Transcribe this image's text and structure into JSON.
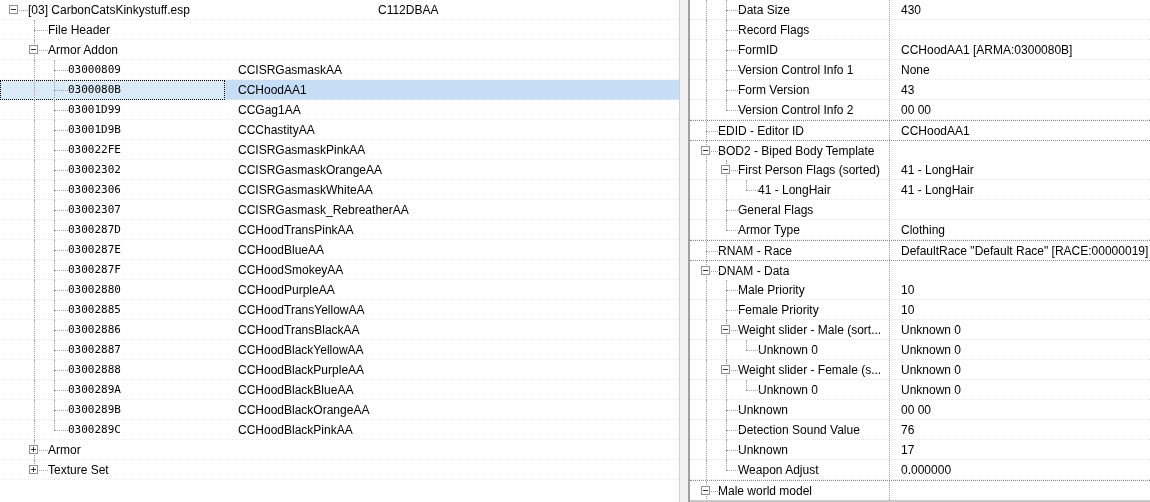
{
  "left_pane": {
    "tree": [
      {
        "label": "[03] CarbonCatsKinkystuff.esp",
        "column_3": "C112DBAA",
        "expanded": true,
        "children": [
          {
            "label": "File Header"
          },
          {
            "label": "Armor Addon",
            "expanded": true,
            "children": [
              {
                "kind": "record",
                "form_id": "03000809",
                "editor_id": "CCISRGasmaskAA",
                "selected": false
              },
              {
                "kind": "record",
                "form_id": "0300080B",
                "editor_id": "CCHoodAA1",
                "selected": true
              },
              {
                "kind": "record",
                "form_id": "03001D99",
                "editor_id": "CCGag1AA",
                "selected": false
              },
              {
                "kind": "record",
                "form_id": "03001D9B",
                "editor_id": "CCChastityAA",
                "selected": false
              },
              {
                "kind": "record",
                "form_id": "030022FE",
                "editor_id": "CCISRGasmaskPinkAA",
                "selected": false
              },
              {
                "kind": "record",
                "form_id": "03002302",
                "editor_id": "CCISRGasmaskOrangeAA",
                "selected": false
              },
              {
                "kind": "record",
                "form_id": "03002306",
                "editor_id": "CCISRGasmaskWhiteAA",
                "selected": false
              },
              {
                "kind": "record",
                "form_id": "03002307",
                "editor_id": "CCISRGasmask_RebreatherAA",
                "selected": false
              },
              {
                "kind": "record",
                "form_id": "0300287D",
                "editor_id": "CCHoodTransPinkAA",
                "selected": false
              },
              {
                "kind": "record",
                "form_id": "0300287E",
                "editor_id": "CCHoodBlueAA",
                "selected": false
              },
              {
                "kind": "record",
                "form_id": "0300287F",
                "editor_id": "CCHoodSmokeyAA",
                "selected": false
              },
              {
                "kind": "record",
                "form_id": "03002880",
                "editor_id": "CCHoodPurpleAA",
                "selected": false
              },
              {
                "kind": "record",
                "form_id": "03002885",
                "editor_id": "CCHoodTransYellowAA",
                "selected": false
              },
              {
                "kind": "record",
                "form_id": "03002886",
                "editor_id": "CCHoodTransBlackAA",
                "selected": false
              },
              {
                "kind": "record",
                "form_id": "03002887",
                "editor_id": "CCHoodBlackYellowAA",
                "selected": false
              },
              {
                "kind": "record",
                "form_id": "03002888",
                "editor_id": "CCHoodBlackPurpleAA",
                "selected": false
              },
              {
                "kind": "record",
                "form_id": "0300289A",
                "editor_id": "CCHoodBlackBlueAA",
                "selected": false
              },
              {
                "kind": "record",
                "form_id": "0300289B",
                "editor_id": "CCHoodBlackOrangeAA",
                "selected": false
              },
              {
                "kind": "record",
                "form_id": "0300289C",
                "editor_id": "CCHoodBlackPinkAA",
                "selected": false
              }
            ]
          },
          {
            "label": "Armor",
            "expanded": false
          },
          {
            "label": "Texture Set",
            "expanded": false
          }
        ]
      }
    ]
  },
  "right_pane": {
    "rows": [
      {
        "children": [
          {
            "label": "Data Size",
            "value": "430"
          },
          {
            "label": "Record Flags"
          },
          {
            "label": "FormID",
            "value": "CCHoodAA1 [ARMA:0300080B]"
          },
          {
            "label": "Version Control Info 1",
            "value": "None"
          },
          {
            "label": "Form Version",
            "value": "43"
          },
          {
            "label": "Version Control Info 2",
            "value": "00 00"
          }
        ]
      },
      {
        "label": "EDID - Editor ID",
        "value": "CCHoodAA1"
      },
      {
        "label": "BOD2 - Biped Body Template",
        "expanded": true,
        "children": [
          {
            "label": "First Person Flags (sorted)",
            "value": "41 - LongHair",
            "expanded": true,
            "children": [
              {
                "label": "41 - LongHair",
                "value": "41 - LongHair"
              }
            ]
          },
          {
            "label": "General Flags"
          },
          {
            "label": "Armor Type",
            "value": "Clothing"
          }
        ]
      },
      {
        "label": "RNAM - Race",
        "value": "DefaultRace \"Default Race\" [RACE:00000019]"
      },
      {
        "label": "DNAM - Data",
        "expanded": true,
        "children": [
          {
            "label": "Male Priority",
            "value": "10"
          },
          {
            "label": "Female Priority",
            "value": "10"
          },
          {
            "label": "Weight slider - Male (sort...",
            "value": "Unknown 0",
            "expanded": true,
            "children": [
              {
                "label": "Unknown 0",
                "value": "Unknown 0"
              }
            ]
          },
          {
            "label": "Weight slider - Female (s...",
            "value": "Unknown 0",
            "expanded": true,
            "children": [
              {
                "label": "Unknown 0",
                "value": "Unknown 0"
              }
            ]
          },
          {
            "label": "Unknown",
            "value": "00 00"
          },
          {
            "label": "Detection Sound Value",
            "value": "76"
          },
          {
            "label": "Unknown",
            "value": "17"
          },
          {
            "label": "Weapon Adjust",
            "value": "0.000000"
          }
        ]
      },
      {
        "label": "Male world model",
        "expanded": true
      }
    ]
  }
}
